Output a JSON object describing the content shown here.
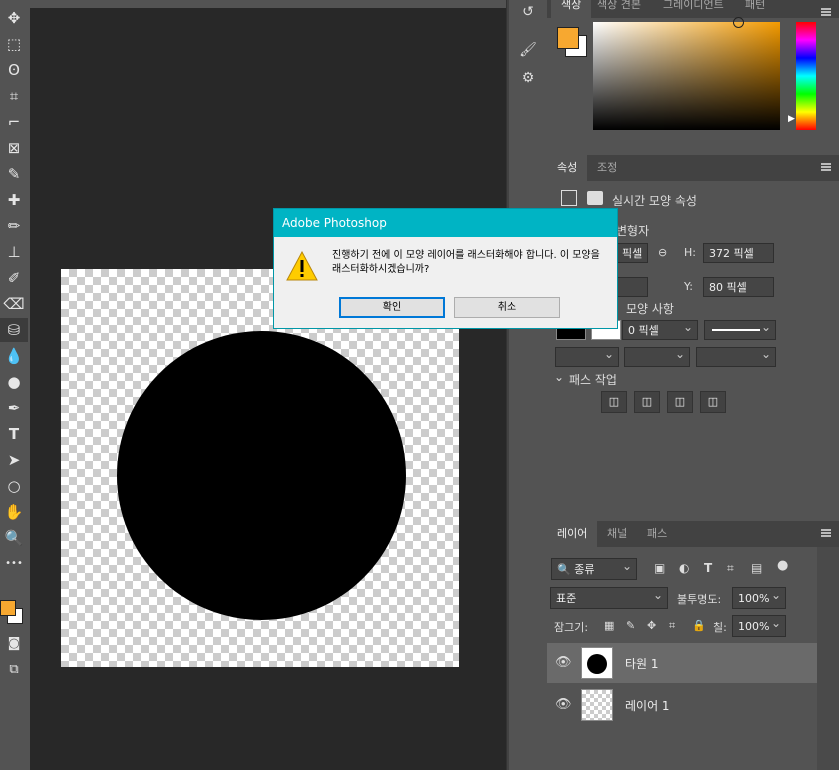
{
  "colors": {
    "foreground": "#f7a830",
    "background": "#ffffff",
    "dialog_title_bg": "#00b4c4"
  },
  "toolbar": {
    "tools": [
      "move-icon",
      "marquee-icon",
      "lasso-icon",
      "quick-select-icon",
      "crop-icon",
      "frame-icon",
      "eyedropper-icon",
      "healing-icon",
      "brush-icon",
      "stamp-icon",
      "history-brush-icon",
      "eraser-icon",
      "paint-bucket-icon",
      "blur-icon",
      "dodge-icon",
      "pen-icon",
      "type-icon",
      "path-select-icon",
      "ellipse-icon",
      "hand-icon",
      "zoom-icon",
      "more-icon"
    ],
    "glyphs": [
      "✥",
      "⬚",
      "ʘ",
      "⌗",
      "⌐",
      "⊠",
      "✎",
      "✚",
      "✏",
      "⊥",
      "✐",
      "⌫",
      "⛁",
      "💧",
      "●",
      "✒",
      "T",
      "➤",
      "○",
      "✋",
      "🔍",
      "•••"
    ]
  },
  "top_panel": {
    "tabs": [
      "색상",
      "색상 견본",
      "그레이디언트",
      "패턴"
    ]
  },
  "properties": {
    "tabs": [
      "속성",
      "조정"
    ],
    "header": "실시간 모양 속성",
    "section_transform": "변형자",
    "w_value": "픽셀",
    "h_label": "H:",
    "h_value": "372 픽셀",
    "y_label": "Y:",
    "y_value": "80 픽셀",
    "section_appearance": "모양 사항",
    "stroke_width": "0 픽셀",
    "section_path": "패스 작업"
  },
  "layers": {
    "tabs": [
      "레이어",
      "채널",
      "패스"
    ],
    "filter": "종류",
    "blend_mode": "표준",
    "opacity_label": "불투명도:",
    "opacity_value": "100%",
    "lock_label": "잠그기:",
    "fill_label": "칠:",
    "fill_value": "100%",
    "items": [
      {
        "name": "타원 1",
        "selected": true
      },
      {
        "name": "레이어 1",
        "selected": false
      }
    ]
  },
  "dialog": {
    "title": "Adobe Photoshop",
    "message": "진행하기 전에 이 모양 레이어를 래스터화해야 합니다. 이 모양을 래스터화하시겠습니까?",
    "ok_label": "확인",
    "cancel_label": "취소"
  }
}
